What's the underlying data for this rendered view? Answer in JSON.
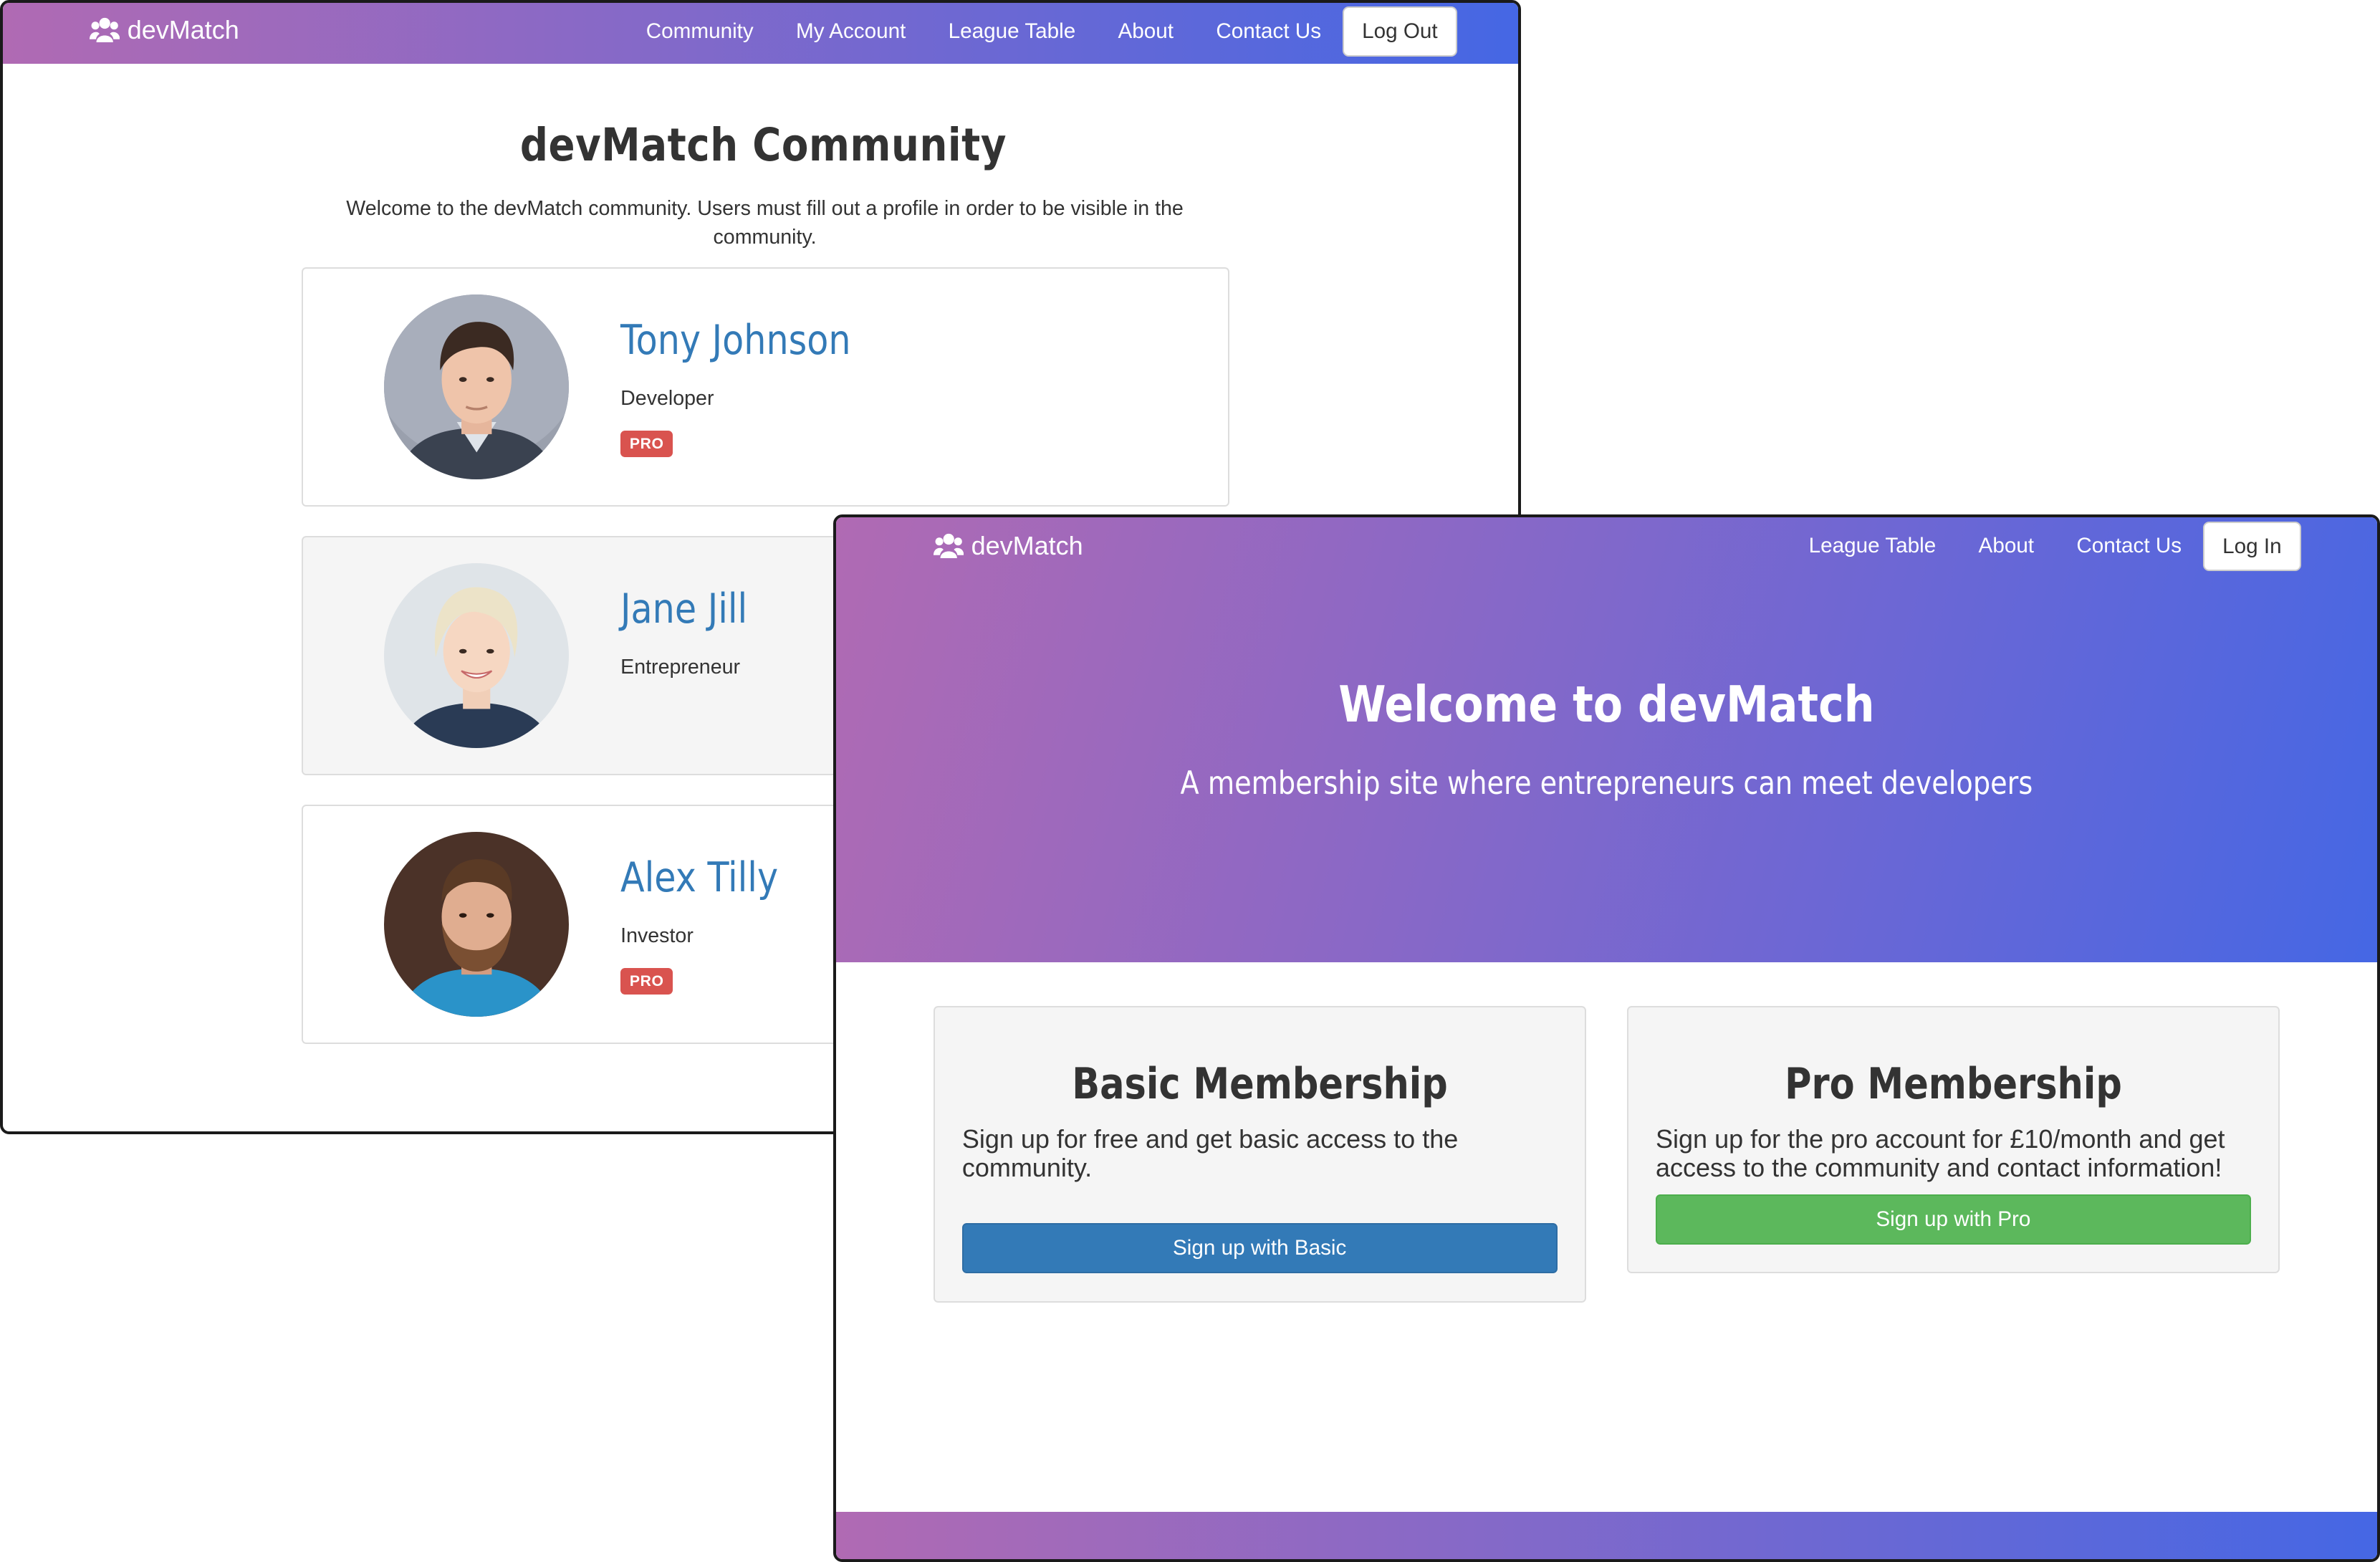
{
  "community_window": {
    "brand": {
      "icon": "users-icon",
      "name": "devMatch"
    },
    "nav": [
      "Community",
      "My Account",
      "League Table",
      "About",
      "Contact Us"
    ],
    "nav_button": "Log Out",
    "title": "devMatch Community",
    "intro": "Welcome to the devMatch community. Users must fill out a profile in order to be visible in the community.",
    "members": [
      {
        "name": "Tony Johnson",
        "role": "Developer",
        "badge": "PRO"
      },
      {
        "name": "Jane Jill",
        "role": "Entrepreneur",
        "badge": ""
      },
      {
        "name": "Alex Tilly",
        "role": "Investor",
        "badge": "PRO"
      }
    ]
  },
  "landing_window": {
    "brand": {
      "icon": "users-icon",
      "name": "devMatch"
    },
    "nav": [
      "League Table",
      "About",
      "Contact Us"
    ],
    "nav_button": "Log In",
    "hero": {
      "title": "Welcome to devMatch",
      "subtitle": "A membership site where entrepreneurs can meet developers"
    },
    "plans": [
      {
        "title": "Basic Membership",
        "description": "Sign up for free and get basic access to the community.",
        "button": "Sign up with Basic"
      },
      {
        "title": "Pro Membership",
        "description": "Sign up for the pro account for £10/month and get access to the community and contact information!",
        "button": "Sign up with Pro"
      }
    ]
  },
  "colors": {
    "gradient_start": "#b06ab3",
    "gradient_end": "#4567e4",
    "link_blue": "#337ab7",
    "badge_red": "#d9534f",
    "primary_button": "#337ab7",
    "success_button": "#5cb85c"
  }
}
